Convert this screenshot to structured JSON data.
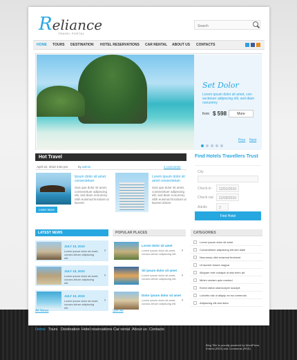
{
  "brand": {
    "logo_initial": "R",
    "logo_rest": "eliance",
    "tagline": "TRAVEL PORTAL"
  },
  "search": {
    "placeholder": "Search"
  },
  "nav": [
    "HOME",
    "TOURS",
    "DESTINATION",
    "HOTEL RESERVATIONS",
    "CAR RENTAL",
    "ABOUT US",
    "CONTACTS"
  ],
  "social": [
    "twitter-icon",
    "facebook-icon",
    "rss-icon"
  ],
  "slide": {
    "title": "Set Dolor",
    "text": "Lorem ipsum dolor sit amet, con-sectetuer adipiscing elit, sed diam nonummy",
    "from": "from",
    "price": "$ 598",
    "more": "More",
    "prev": "Prev",
    "next": "Next"
  },
  "hot": {
    "title": "Hot Travel",
    "date": "April 22, 2010 3:54 pm",
    "by": "by",
    "author": "admin",
    "comments": "2 comments",
    "item1_title": "Ipsum dolor sit amet consectetuer",
    "item1_text": "Suis que dolor sit amet, consectetuer adipiscing elit, sed diam nonummy nibh euismod tincidunt ut laoreet",
    "item2_title": "Lorem ipsum dolor sit amet consectetuer",
    "item2_text": "Suis que dolor sit amet, consectetuer adipiscing elit, sed diam nonummy nibh euismod tincidunt ut laoreet dolore",
    "learn": "Learn More"
  },
  "finder": {
    "title": "Find Hotels Travellers Trust",
    "city": "City",
    "checkin": "Check-in",
    "checkin_val": "12/01/2010",
    "checkout": "Check-out",
    "checkout_val": "12/09/2010",
    "adults": "Adults",
    "adults_val": "2",
    "button": "Find Hotel"
  },
  "news": {
    "title": "LATEST NEWS",
    "items": [
      {
        "date": "JULY 10, 2010",
        "text": "Lorem ipsum dolor sit amet, consec-tetuer adipiscing elit."
      },
      {
        "date": "JULY 10, 2010",
        "text": "Lorem ipsum dolor sit amet, consec-tetuer adipiscing elit."
      },
      {
        "date": "JULY 10, 2010",
        "text": "Lorem ipsum dolor sit amet, consec-tetuer adipiscing elit."
      }
    ],
    "viewall": "All News"
  },
  "popular": {
    "title": "POPULAR PLACES",
    "items": [
      {
        "title": "Lorem dolor sit amet",
        "text": "Lorem ipsum dolor sit amet, consec-tetuer adipiscing elit."
      },
      {
        "title": "Sit ipsum dolor sit amet",
        "text": "Lorem ipsum dolor sit amet, consec-tetuer adipiscing elit."
      },
      {
        "title": "Dolor ipsum dolor sit amet",
        "text": "Lorem ipsum dolor sit amet, consec-tetuer adipiscing elit."
      }
    ],
    "viewall": "See All"
  },
  "categories": {
    "title": "CATEGORIES",
    "items": [
      "Lorem ipsum dolor sit amet",
      "Consectetuer adipiscing elit sed diam",
      "Nonummy nibh euismod tincidunt",
      "Ut laoreet dolore magna",
      "Aliquam erat volutpat ut wisi enim ad",
      "Minim veniam quis nostrud",
      "Exerci tation ullamcorper suscipit",
      "Lobortis nisl ut aliquip ex ea commodo",
      "Adipiscing elit sed diam"
    ]
  },
  "footer": {
    "nav": [
      "Home",
      "Tours",
      "Destination",
      "Hotel reservations",
      "Car rental",
      "About us",
      "Contacts"
    ],
    "copy": "Blog Title is proudly powered by WordPress Entries (RSS) and Comments (RSS)"
  },
  "colors": {
    "accent": "#27a7e0",
    "dark": "#2d2d2d"
  }
}
